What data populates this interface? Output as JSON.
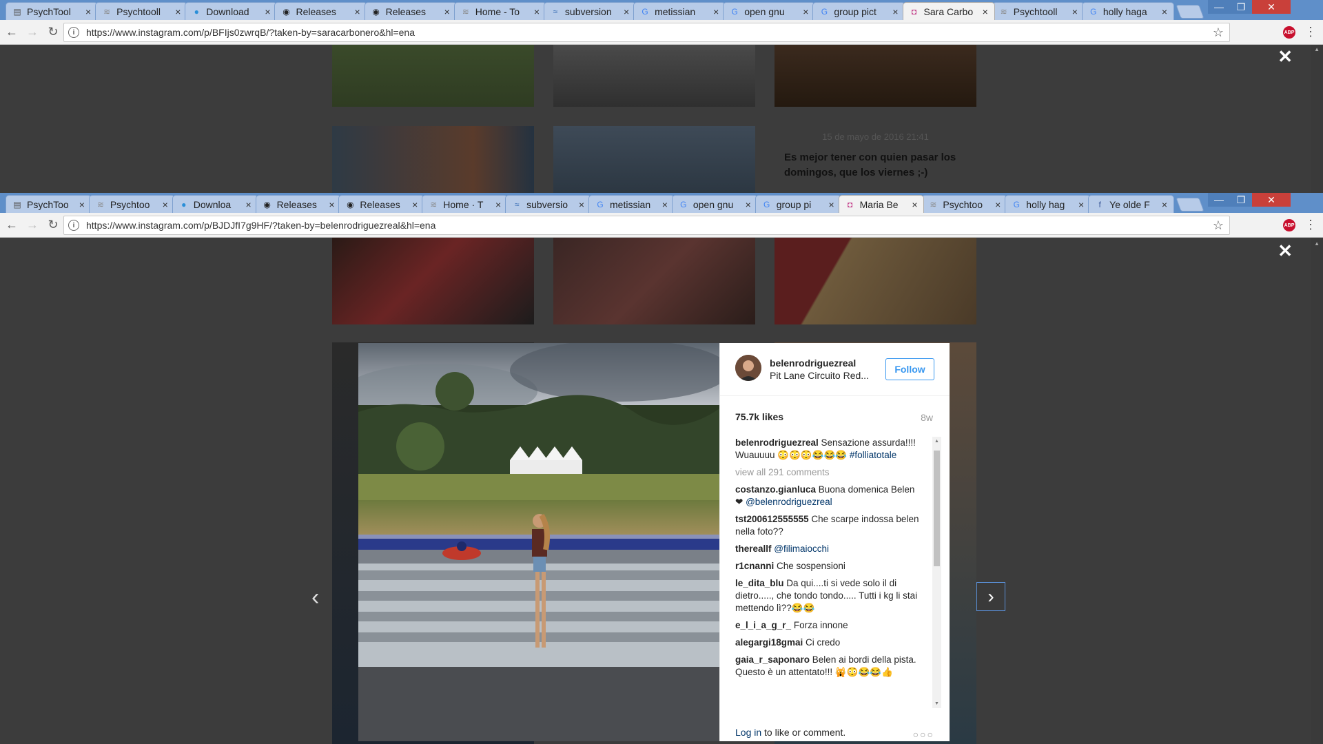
{
  "window1": {
    "tabs": [
      {
        "title": "PsychTool",
        "icon": "document-icon"
      },
      {
        "title": "Psychtooll",
        "icon": "wave-icon"
      },
      {
        "title": "Download",
        "icon": "dot-icon"
      },
      {
        "title": "Releases",
        "icon": "github-icon"
      },
      {
        "title": "Releases",
        "icon": "github-icon"
      },
      {
        "title": "Home - To",
        "icon": "wave-icon"
      },
      {
        "title": "subversion",
        "icon": "svn-icon"
      },
      {
        "title": "metissian",
        "icon": "google-icon"
      },
      {
        "title": "open gnu",
        "icon": "google-icon"
      },
      {
        "title": "group pict",
        "icon": "google-icon"
      },
      {
        "title": "Sara Carbo",
        "icon": "instagram-icon"
      },
      {
        "title": "Psychtooll",
        "icon": "wave-icon"
      },
      {
        "title": "holly haga",
        "icon": "google-icon"
      }
    ],
    "active_tab": 10,
    "url": "https://www.instagram.com/p/BFIjs0zwrqB/?taken-by=saracarbonero&hl=ena",
    "post_date": "15 de mayo de 2016 21:41",
    "post_text": "Es mejor tener con quien pasar los domingos, que los viernes ;-)"
  },
  "window2": {
    "tabs": [
      {
        "title": "PsychToo",
        "icon": "document-icon"
      },
      {
        "title": "Psychtoo",
        "icon": "wave-icon"
      },
      {
        "title": "Downloa",
        "icon": "dot-icon"
      },
      {
        "title": "Releases",
        "icon": "github-icon"
      },
      {
        "title": "Releases",
        "icon": "github-icon"
      },
      {
        "title": "Home · T",
        "icon": "wave-icon"
      },
      {
        "title": "subversio",
        "icon": "svn-icon"
      },
      {
        "title": "metissian",
        "icon": "google-icon"
      },
      {
        "title": "open gnu",
        "icon": "google-icon"
      },
      {
        "title": "group pi",
        "icon": "google-icon"
      },
      {
        "title": "Maria Be",
        "icon": "instagram-icon"
      },
      {
        "title": "Psychtoo",
        "icon": "wave-icon"
      },
      {
        "title": "holly hag",
        "icon": "google-icon"
      },
      {
        "title": "Ye olde F",
        "icon": "facebook-icon"
      }
    ],
    "active_tab": 10,
    "url": "https://www.instagram.com/p/BJDJfI7g9HF/?taken-by=belenrodriguezreal&hl=ena"
  },
  "post": {
    "username": "belenrodriguezreal",
    "location": "Pit Lane Circuito Red...",
    "follow_label": "Follow",
    "likes": "75.7k likes",
    "age": "8w",
    "caption_user": "belenrodriguezreal",
    "caption_text": " Sensazione assurda!!!! Wuauuuu 😳😳😳😂😂😂 ",
    "caption_tag": "#folliatotale",
    "view_all": "view all 291 comments",
    "comments": [
      {
        "user": "costanzo.gianluca",
        "text": " Buona domenica Belen ❤ ",
        "tag": "@belenrodriguezreal"
      },
      {
        "user": "tst200612555555",
        "text": " Che scarpe indossa belen nella foto??",
        "tag": ""
      },
      {
        "user": "thereallf",
        "text": " ",
        "tag": "@filimaiocchi"
      },
      {
        "user": "r1cnanni",
        "text": " Che sospensioni",
        "tag": ""
      },
      {
        "user": "le_dita_blu",
        "text": " Da qui....ti si vede solo il di dietro....., che tondo tondo..... Tutti i kg li stai mettendo lì??😂😂",
        "tag": ""
      },
      {
        "user": "e_l_i_a_g_r_",
        "text": " Forza innone",
        "tag": ""
      },
      {
        "user": "alegargi18gmai",
        "text": " Ci credo",
        "tag": ""
      },
      {
        "user": "gaia_r_saponaro",
        "text": " Belen ai bordi della pista. Questo è un attentato!!! 🙀😳😂😂👍",
        "tag": ""
      }
    ],
    "login_link": "Log in",
    "login_text": " to like or comment.",
    "more": "○○○"
  },
  "controls": {
    "close_glyph": "✕",
    "prev_glyph": "‹",
    "next_glyph": "›",
    "back_glyph": "←",
    "forward_glyph": "→",
    "reload_glyph": "↻",
    "star_glyph": "☆",
    "menu_glyph": "⋮",
    "abp_label": "ABP",
    "info_glyph": "i",
    "tab_close_glyph": "×",
    "win_minimize": "—",
    "win_restore": "❐",
    "win_close": "✕"
  },
  "colors": {
    "tabstrip": "#5f8fc9",
    "instagram_blue": "#3897f0",
    "overlay": "#3c3c3c"
  }
}
